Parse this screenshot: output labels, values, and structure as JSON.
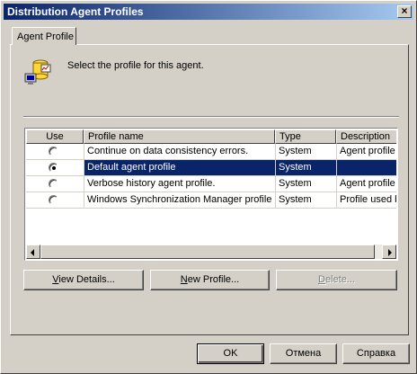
{
  "window": {
    "title": "Distribution Agent Profiles",
    "close_glyph": "×"
  },
  "tabs": [
    {
      "label": "Agent Profile",
      "active": true
    }
  ],
  "panel": {
    "prompt": "Select the profile for this agent.",
    "icon": "agent-database-icon"
  },
  "table": {
    "columns": [
      "Use",
      "Profile name",
      "Type",
      "Description"
    ],
    "rows": [
      {
        "selected": false,
        "name": "Continue on data consistency errors.",
        "type": "System",
        "description": "Agent profile f"
      },
      {
        "selected": true,
        "name": "Default agent profile",
        "type": "System",
        "description": ""
      },
      {
        "selected": false,
        "name": "Verbose history agent profile.",
        "type": "System",
        "description": "Agent profile f"
      },
      {
        "selected": false,
        "name": "Windows Synchronization Manager profile",
        "type": "System",
        "description": "Profile used b"
      }
    ]
  },
  "buttons": {
    "view_details": {
      "pre": "",
      "key": "V",
      "post": "iew Details..."
    },
    "new_profile": {
      "pre": "",
      "key": "N",
      "post": "ew Profile..."
    },
    "delete": {
      "pre": "",
      "key": "D",
      "post": "elete...",
      "enabled": false
    },
    "ok": "OK",
    "cancel": "Отмена",
    "help": "Справка"
  },
  "colors": {
    "title_start": "#0a246a",
    "title_end": "#a6caf0",
    "selection": "#0a246a",
    "face": "#d4d0c8"
  }
}
